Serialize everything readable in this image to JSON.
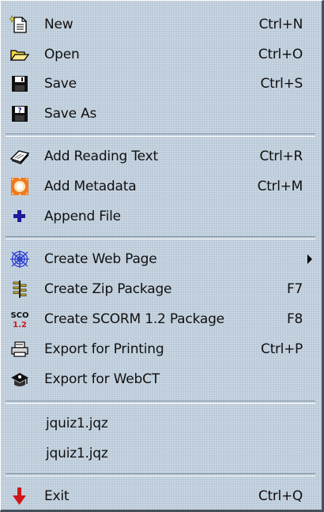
{
  "menu": {
    "items": [
      {
        "id": "new",
        "label": "New",
        "shortcut": "Ctrl+N",
        "icon": "new-file-icon"
      },
      {
        "id": "open",
        "label": "Open",
        "shortcut": "Ctrl+O",
        "icon": "open-folder-icon"
      },
      {
        "id": "save",
        "label": "Save",
        "shortcut": "Ctrl+S",
        "icon": "floppy-disk-icon"
      },
      {
        "id": "save-as",
        "label": "Save As",
        "shortcut": "",
        "icon": "floppy-question-icon"
      },
      {
        "id": "add-reading-text",
        "label": "Add Reading Text",
        "shortcut": "Ctrl+R",
        "icon": "book-icon"
      },
      {
        "id": "add-metadata",
        "label": "Add Metadata",
        "shortcut": "Ctrl+M",
        "icon": "metadata-icon"
      },
      {
        "id": "append-file",
        "label": "Append File",
        "shortcut": "",
        "icon": "plus-icon"
      },
      {
        "id": "create-web-page",
        "label": "Create Web Page",
        "shortcut": "",
        "icon": "web-icon",
        "submenu": true
      },
      {
        "id": "create-zip-package",
        "label": "Create Zip Package",
        "shortcut": "F7",
        "icon": "zip-icon"
      },
      {
        "id": "create-scorm-package",
        "label": "Create SCORM 1.2 Package",
        "shortcut": "F8",
        "icon": "scorm-icon",
        "icon_text_top": "SCO",
        "icon_text_bottom": "1.2"
      },
      {
        "id": "export-printing",
        "label": "Export for Printing",
        "shortcut": "Ctrl+P",
        "icon": "printer-icon"
      },
      {
        "id": "export-webct",
        "label": "Export for WebCT",
        "shortcut": "",
        "icon": "webct-icon"
      },
      {
        "id": "recent-1",
        "label": "jquiz1.jqz",
        "shortcut": ""
      },
      {
        "id": "recent-2",
        "label": "jquiz1.jqz",
        "shortcut": ""
      },
      {
        "id": "exit",
        "label": "Exit",
        "shortcut": "Ctrl+Q",
        "icon": "exit-arrow-icon"
      }
    ]
  },
  "colors": {
    "menu_background": "#b9c9d8",
    "text": "#101010",
    "separator_shadow": "#7e8e9e",
    "separator_highlight": "#ffffff",
    "open_folder": "#f2d53f",
    "metadata": "#f07a22",
    "append": "#1c1c9c",
    "exit_arrow": "#d01818",
    "scorm_bottom": "#c81818"
  }
}
